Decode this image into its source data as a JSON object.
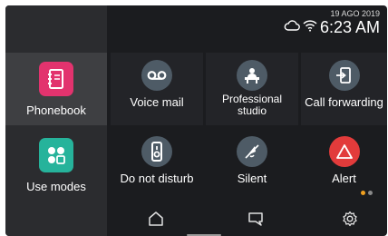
{
  "status": {
    "date": "19 AGO 2019",
    "time": "6:23 AM",
    "icons": [
      "cloud-icon",
      "wifi-icon"
    ]
  },
  "sidebar": {
    "items": [
      {
        "label": "Phonebook",
        "icon": "phonebook-icon",
        "color": "#e2336e"
      },
      {
        "label": "Use modes",
        "icon": "use-modes-icon",
        "color": "#26b39b"
      }
    ]
  },
  "tiles": [
    {
      "label": "Voice mail",
      "icon": "voicemail-icon"
    },
    {
      "label": "Professional studio",
      "icon": "professional-studio-icon"
    },
    {
      "label": "Call forwarding",
      "icon": "call-forwarding-icon"
    },
    {
      "label": "Do not disturb",
      "icon": "do-not-disturb-icon"
    },
    {
      "label": "Silent",
      "icon": "silent-icon"
    },
    {
      "label": "Alert",
      "icon": "alert-icon",
      "color": "#e23b3b"
    }
  ],
  "nav": {
    "items": [
      "home-icon",
      "messages-icon",
      "settings-icon"
    ]
  },
  "pager": {
    "active_color": "#f0a020",
    "inactive_color": "#8a8a8a"
  },
  "colors": {
    "background": "#1b1c1f",
    "sidebar": "#2b2c2f",
    "round_button": "#4e5b66"
  }
}
